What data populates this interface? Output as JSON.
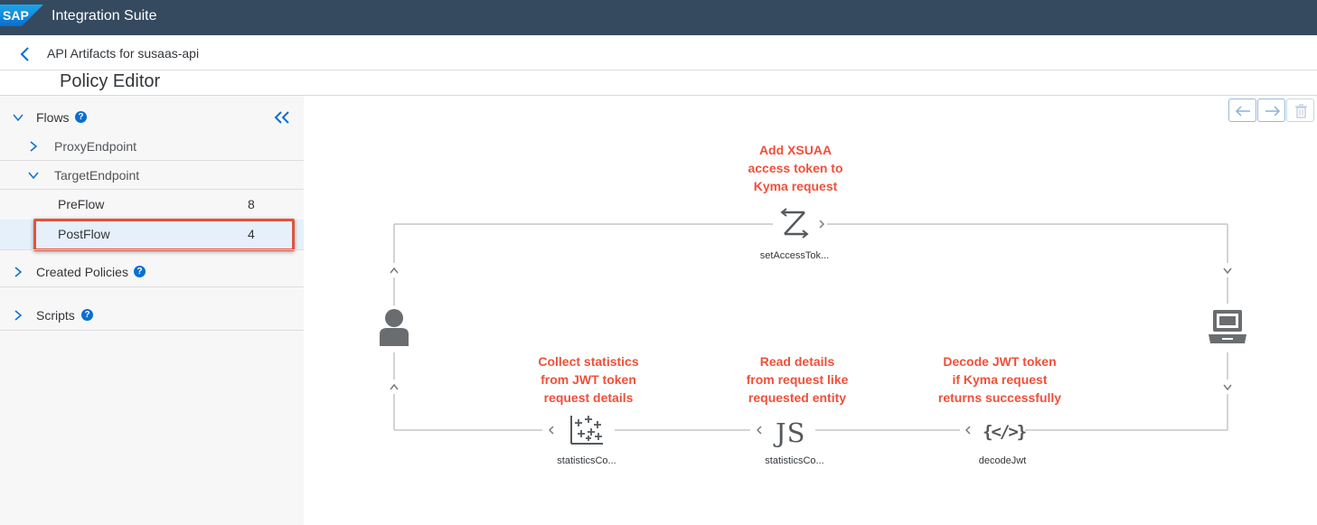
{
  "shell": {
    "logo_text": "SAP",
    "app_title": "Integration Suite"
  },
  "header": {
    "breadcrumb": "API Artifacts for susaas-api",
    "page_title": "Policy Editor"
  },
  "sidebar": {
    "flows_label": "Flows",
    "proxy_endpoint": "ProxyEndpoint",
    "target_endpoint": "TargetEndpoint",
    "preflow_label": "PreFlow",
    "preflow_count": "8",
    "postflow_label": "PostFlow",
    "postflow_count": "4",
    "created_policies": "Created Policies",
    "scripts": "Scripts",
    "help_glyph": "?"
  },
  "canvas": {
    "top_note": [
      "Add XSUAA",
      "access token to",
      "Kyma request"
    ],
    "top_policy": "setAccessTok...",
    "notes": {
      "left": [
        "Collect statistics",
        "from JWT token",
        "request details"
      ],
      "middle": [
        "Read details",
        "from request like",
        "requested entity"
      ],
      "right": [
        "Decode JWT token",
        "if Kyma request",
        "returns successfully"
      ]
    },
    "bottom_policies": [
      "statisticsCo...",
      "statisticsCo...",
      "decodeJwt"
    ],
    "js_glyph": "JS",
    "code_glyph": "{</>}",
    "note_color": "#f0503a"
  },
  "colors": {
    "shell_bg": "#354a5f",
    "accent": "#0a6ed1",
    "highlight": "#e2533e",
    "selected_row": "#e5f0fa"
  }
}
